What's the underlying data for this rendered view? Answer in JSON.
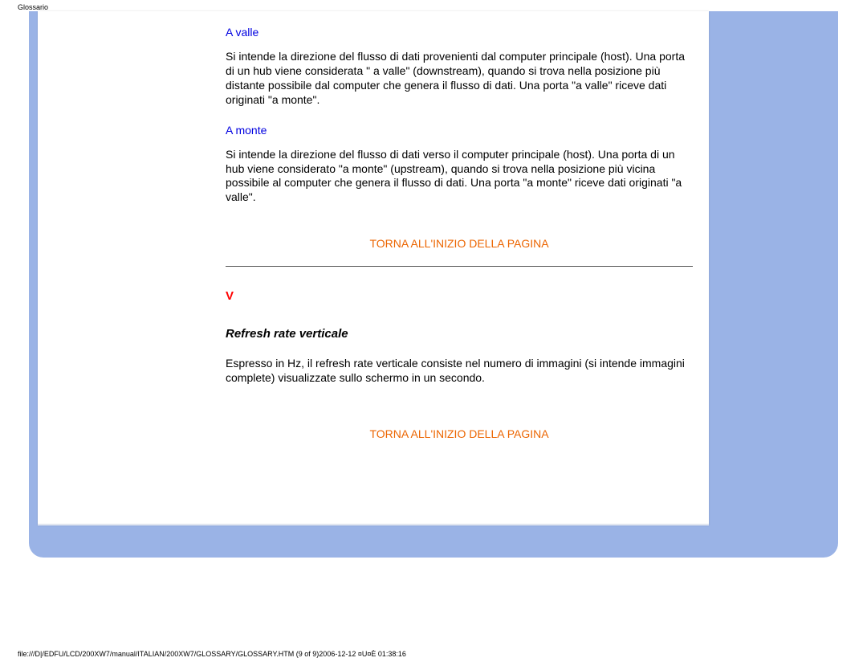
{
  "header": {
    "label": "Glossario"
  },
  "content": {
    "term1": {
      "heading": "A valle",
      "body": "Si intende la direzione del flusso di dati provenienti dal computer principale (host). Una porta di un hub viene considerata \" a valle\" (downstream), quando si trova nella posizione più distante possibile dal computer che genera il flusso di dati. Una porta \"a valle\" riceve dati originati \"a monte\"."
    },
    "term2": {
      "heading": "A monte",
      "body": "Si intende la direzione del flusso di dati verso il computer principale (host). Una porta di un hub viene considerato \"a monte\" (upstream), quando si trova nella posizione più vicina possibile al computer che genera il flusso di dati. Una porta \"a monte\" riceve dati originati \"a valle\"."
    },
    "backToTop": "TORNA ALL'INIZIO DELLA PAGINA",
    "sectionLetter": "V",
    "subheading": "Refresh rate verticale",
    "subheadingBody": "Espresso in Hz, il refresh rate verticale consiste nel numero di immagini (si intende immagini complete) visualizzate sullo schermo in un secondo."
  },
  "footer": {
    "text": "file:///D|/EDFU/LCD/200XW7/manual/ITALIAN/200XW7/GLOSSARY/GLOSSARY.HTM (9 of 9)2006-12-12 ¤U¤È 01:38:16"
  }
}
